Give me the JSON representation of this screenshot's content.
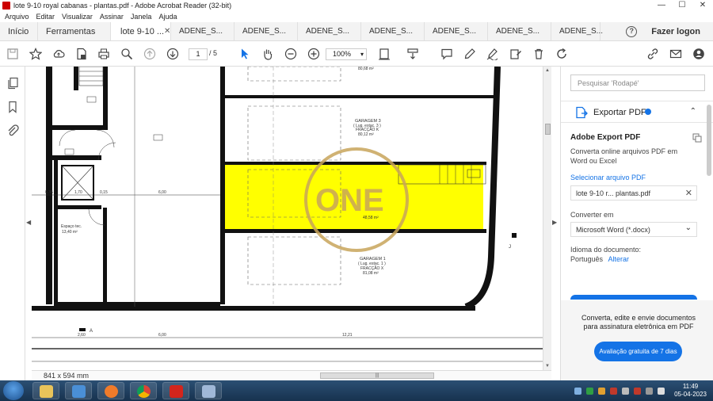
{
  "window": {
    "title": "lote 9-10 royal cabanas - plantas.pdf - Adobe Acrobat Reader (32-bit)",
    "controls": [
      "—",
      "☐",
      "✕"
    ]
  },
  "menu": [
    "Arquivo",
    "Editar",
    "Visualizar",
    "Assinar",
    "Janela",
    "Ajuda"
  ],
  "tabs": {
    "home": "Início",
    "tools": "Ferramentas",
    "active": "lote 9-10 ...",
    "others": [
      "ADENE_S...",
      "ADENE_S...",
      "ADENE_S...",
      "ADENE_S...",
      "ADENE_S...",
      "ADENE_S...",
      "ADENE_S..."
    ],
    "help": "?",
    "login": "Fazer logon"
  },
  "toolbar": {
    "page_current": "1",
    "page_total": "/ 5",
    "zoom": "100%"
  },
  "drawing": {
    "labels": {
      "area_top": "80,68 m²",
      "garage3_name": "GARAGEM 3",
      "garage3_sub": "( Lug. estac. 3 )",
      "garage3_frac": "FRACÇÃO K",
      "garage3_area": "80,12 m²",
      "garage1_name": "GARAGEM 1",
      "garage1_sub": "( Lug. estac. 1 )",
      "garage1_frac": "FRACÇÃO X",
      "garage1_area": "81,08 m²",
      "yellow_area": "48,58 m²",
      "espaco": "Espaço tec.",
      "espaco_area": "13,40 m²",
      "dim_600": "6,00",
      "dim_035": "0,35",
      "dim_015": "0,15",
      "dim_170": "1,70",
      "dim_260": "2,60",
      "dim_1221": "12,21",
      "marker_a": "A",
      "marker_j": "J",
      "watermark": "ONE"
    }
  },
  "status": {
    "page_size": "841 x 594 mm"
  },
  "right_panel": {
    "search_placeholder": "Pesquisar 'Rodapé'",
    "export_header": "Exportar PDF",
    "title": "Adobe Export PDF",
    "description": "Converta online arquivos PDF em Word ou Excel",
    "select_file": "Selecionar arquivo PDF",
    "file_name": "lote 9-10 r... plantas.pdf",
    "convert_label": "Converter em",
    "convert_value": "Microsoft Word (*.docx)",
    "language_label": "Idioma do documento:",
    "language_value": "Português",
    "language_change": "Alterar",
    "promo_text": "Converta, edite e envie documentos para assinatura eletrônica em PDF",
    "promo_button": "Avaliação gratuita de 7 dias"
  },
  "taskbar": {
    "time": "11:49",
    "date": "05-04-2023"
  },
  "colors": {
    "accent": "#1473e6",
    "highlight_yellow": "#ffff00",
    "watermark_gold": "#c8a55a"
  }
}
